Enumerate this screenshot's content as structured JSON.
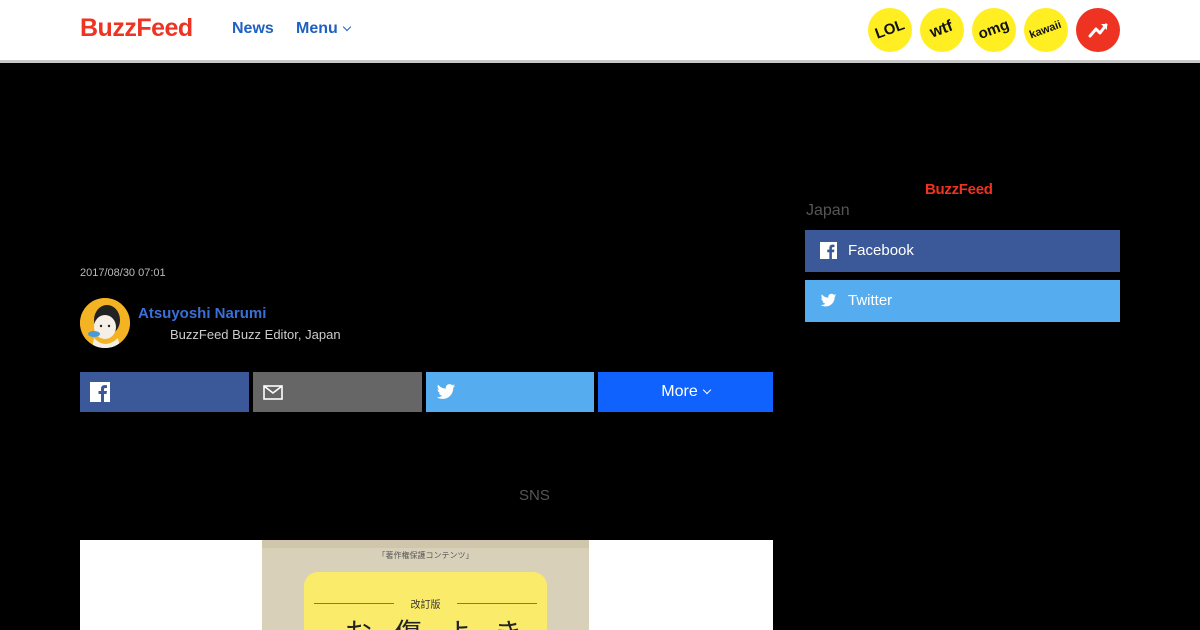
{
  "header": {
    "logo": "BuzzFeed",
    "nav": {
      "news": "News",
      "menu": "Menu"
    },
    "badges": [
      "LOL",
      "wtf",
      "omg",
      "kawaii"
    ],
    "trending_icon": "trending-arrow-icon"
  },
  "article": {
    "date": "2017/08/30 07:01",
    "author": {
      "name": "Atsuyoshi Narumi",
      "title": "BuzzFeed Buzz Editor, Japan"
    },
    "share": {
      "more_label": "More"
    },
    "sns_text": "SNS",
    "image": {
      "book_top_text": "「著作権保護コンテンツ」",
      "book_label_text": "改訂版",
      "book_chars": "お傷よき"
    }
  },
  "sidebar": {
    "logo": "BuzzFeed",
    "region": "Japan",
    "facebook": "Facebook",
    "twitter": "Twitter"
  },
  "colors": {
    "brand_red": "#ee3322",
    "link_blue": "#2060c0",
    "facebook": "#3b5998",
    "twitter": "#55acee",
    "more_blue": "#0f62fe",
    "badge_yellow": "#ffee22"
  }
}
